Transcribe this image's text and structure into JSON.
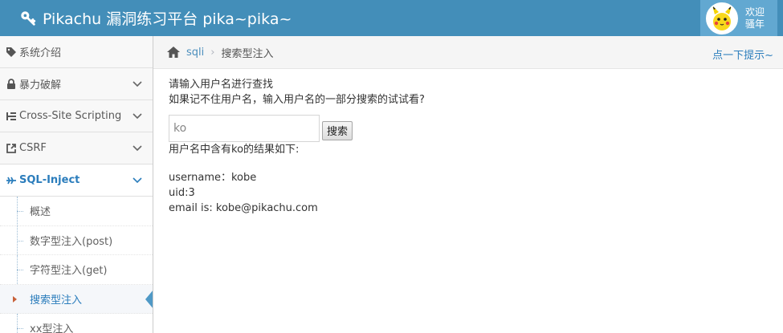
{
  "header": {
    "brand_title": "Pikachu 漏洞练习平台 pika~pika~",
    "welcome": "欢迎",
    "username": "骚年"
  },
  "sidebar": {
    "items": [
      {
        "label": "系统介绍",
        "icon": "tag-icon"
      },
      {
        "label": "暴力破解",
        "icon": "lock-icon"
      },
      {
        "label": "Cross-Site Scripting",
        "icon": "sitemap-icon"
      },
      {
        "label": "CSRF",
        "icon": "external-link-icon"
      },
      {
        "label": "SQL-Inject",
        "icon": "plane-icon"
      }
    ],
    "sub_items": [
      {
        "label": "概述"
      },
      {
        "label": "数字型注入(post)"
      },
      {
        "label": "字符型注入(get)"
      },
      {
        "label": "搜索型注入"
      },
      {
        "label": "xx型注入"
      }
    ]
  },
  "breadcrumb": {
    "link": "sqli",
    "current": "搜索型注入",
    "hint": "点一下提示~"
  },
  "main": {
    "prompt_line1": "请输入用户名进行查找",
    "prompt_line2": "如果记不住用户名，输入用户名的一部分搜索的试试看?",
    "search_value": "ko",
    "search_button": "搜索",
    "result_header": "用户名中含有ko的结果如下:",
    "result_username": "username：kobe",
    "result_uid": "uid:3",
    "result_email": "email is: kobe@pikachu.com"
  },
  "colors": {
    "navbar": "#438eb9",
    "user_box": "#62a8d1",
    "accent": "#2b7dbc",
    "active_caret": "#c86139"
  }
}
